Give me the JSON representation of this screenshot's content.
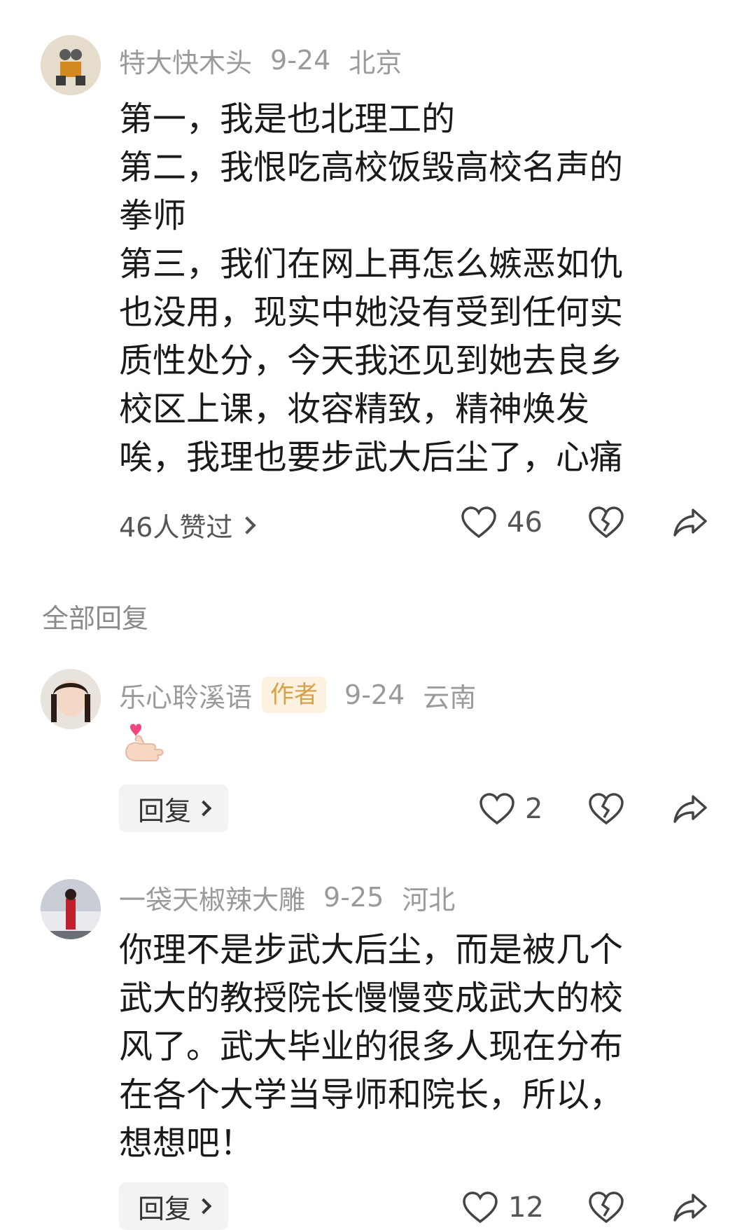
{
  "comments": [
    {
      "username": "特大快木头",
      "date": "9-24",
      "location": "北京",
      "lines": [
        "第一，我是也北理工的",
        "第二，我恨吃高校饭毁高校名声的",
        "拳师",
        "第三，我们在网上再怎么嫉恶如仇",
        "也没用，现实中她没有受到任何实",
        "质性处分，今天我还见到她去良乡",
        "校区上课，妆容精致，精神焕发",
        "唉，我理也要步武大后尘了，心痛"
      ],
      "likes_summary": "46人赞过",
      "like_count": "46"
    },
    {
      "username": "乐心聆溪语",
      "badge": "作者",
      "date": "9-24",
      "location": "云南",
      "content_icon": "heart-hand-emoji",
      "reply_label": "回复",
      "like_count": "2"
    },
    {
      "username": "一袋天椒辣大雕",
      "date": "9-25",
      "location": "河北",
      "lines": [
        "你理不是步武大后尘，而是被几个",
        "武大的教授院长慢慢变成武大的校",
        "风了。武大毕业的很多人现在分布",
        "在各个大学当导师和院长，所以，",
        "想想吧！"
      ],
      "reply_label": "回复",
      "like_count": "12"
    }
  ],
  "section_title": "全部回复",
  "icons": {
    "like": "heart-outline-icon",
    "dislike": "broken-heart-icon",
    "share": "share-arrow-icon"
  }
}
